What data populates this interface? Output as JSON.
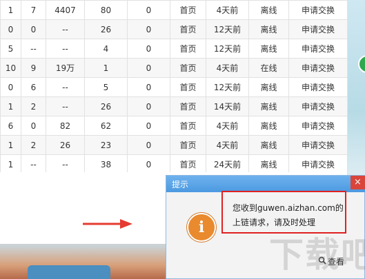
{
  "table": {
    "rows": [
      [
        "1",
        "7",
        "4407",
        "80",
        "0",
        "首页",
        "4天前",
        "离线",
        "申请交换"
      ],
      [
        "0",
        "0",
        "--",
        "26",
        "0",
        "首页",
        "12天前",
        "离线",
        "申请交换"
      ],
      [
        "5",
        "--",
        "--",
        "4",
        "0",
        "首页",
        "12天前",
        "离线",
        "申请交换"
      ],
      [
        "10",
        "9",
        "19万",
        "1",
        "0",
        "首页",
        "4天前",
        "在线",
        "申请交换"
      ],
      [
        "0",
        "6",
        "--",
        "5",
        "0",
        "首页",
        "12天前",
        "离线",
        "申请交换"
      ],
      [
        "1",
        "2",
        "--",
        "26",
        "0",
        "首页",
        "14天前",
        "离线",
        "申请交换"
      ],
      [
        "6",
        "0",
        "82",
        "62",
        "0",
        "首页",
        "4天前",
        "离线",
        "申请交换"
      ],
      [
        "1",
        "2",
        "26",
        "23",
        "0",
        "首页",
        "4天前",
        "离线",
        "申请交换"
      ],
      [
        "1",
        "--",
        "--",
        "38",
        "0",
        "首页",
        "24天前",
        "离线",
        "申请交换"
      ]
    ]
  },
  "popup": {
    "title": "提示",
    "close": "×",
    "message_line1": "您收到guwen.aizhan.com的",
    "message_line2": "上链请求，请及时处理",
    "view_label": "查看"
  },
  "watermark": "下载吧",
  "colors": {
    "link": "#3a7bc8",
    "title_bar": "#4c99e0",
    "alert_border": "#e02020",
    "icon": "#e98a2e"
  }
}
